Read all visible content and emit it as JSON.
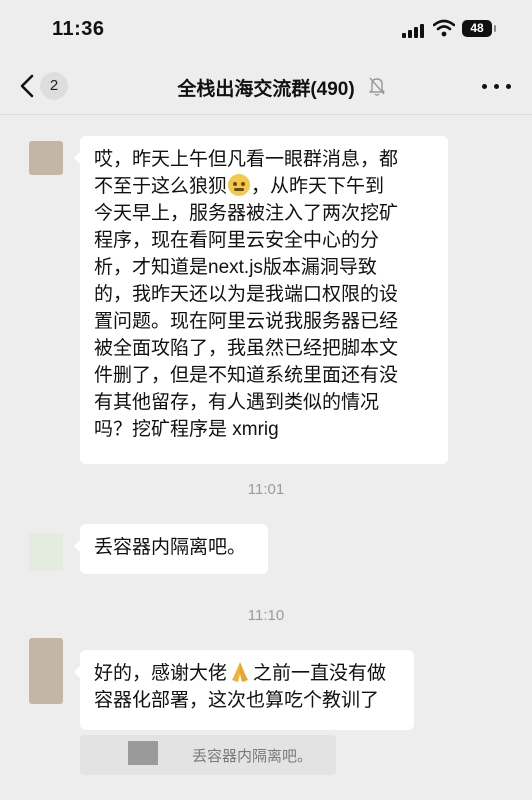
{
  "status_bar": {
    "time": "11:36",
    "battery": "48"
  },
  "nav": {
    "unread_count": "2",
    "title": "全栈出海交流群(490)"
  },
  "messages": [
    {
      "type": "text",
      "lines": [
        "哎，昨天上午但凡看一眼群消息，都",
        "不至于这么狼狈",
        "，从昨天下午到",
        "今天早上，服务器被注入了两次挖矿",
        "程序，现在看阿里云安全中心的分",
        "析，才知道是next.js版本漏洞导致",
        "的，我昨天还以为是我端口权限的设",
        "置问题。现在阿里云说我服务器已经",
        "被全面攻陷了，我虽然已经把脚本文",
        "件删了，但是不知道系统里面还有没",
        "有其他留存，有人遇到类似的情况",
        "吗？挖矿程序是 xmrig"
      ]
    },
    {
      "type": "time",
      "text": "11:01"
    },
    {
      "type": "text",
      "text": "丢容器内隔离吧。"
    },
    {
      "type": "time",
      "text": "11:10"
    },
    {
      "type": "text",
      "lines": [
        "好的，感谢大佬",
        "之前一直没有做",
        "容器化部署，这次也算吃个教训了"
      ],
      "quote": "丢容器内隔离吧。"
    }
  ],
  "icons": {
    "back": "chevron-left-icon",
    "mute": "bell-slash-icon",
    "more": "more-dots-icon",
    "emoji1": "grimace-emoji-icon",
    "emoji2": "pray-emoji-icon"
  },
  "colors": {
    "background": "#ededed",
    "bubble": "#ffffff",
    "timestamp": "#9a9a9a"
  }
}
